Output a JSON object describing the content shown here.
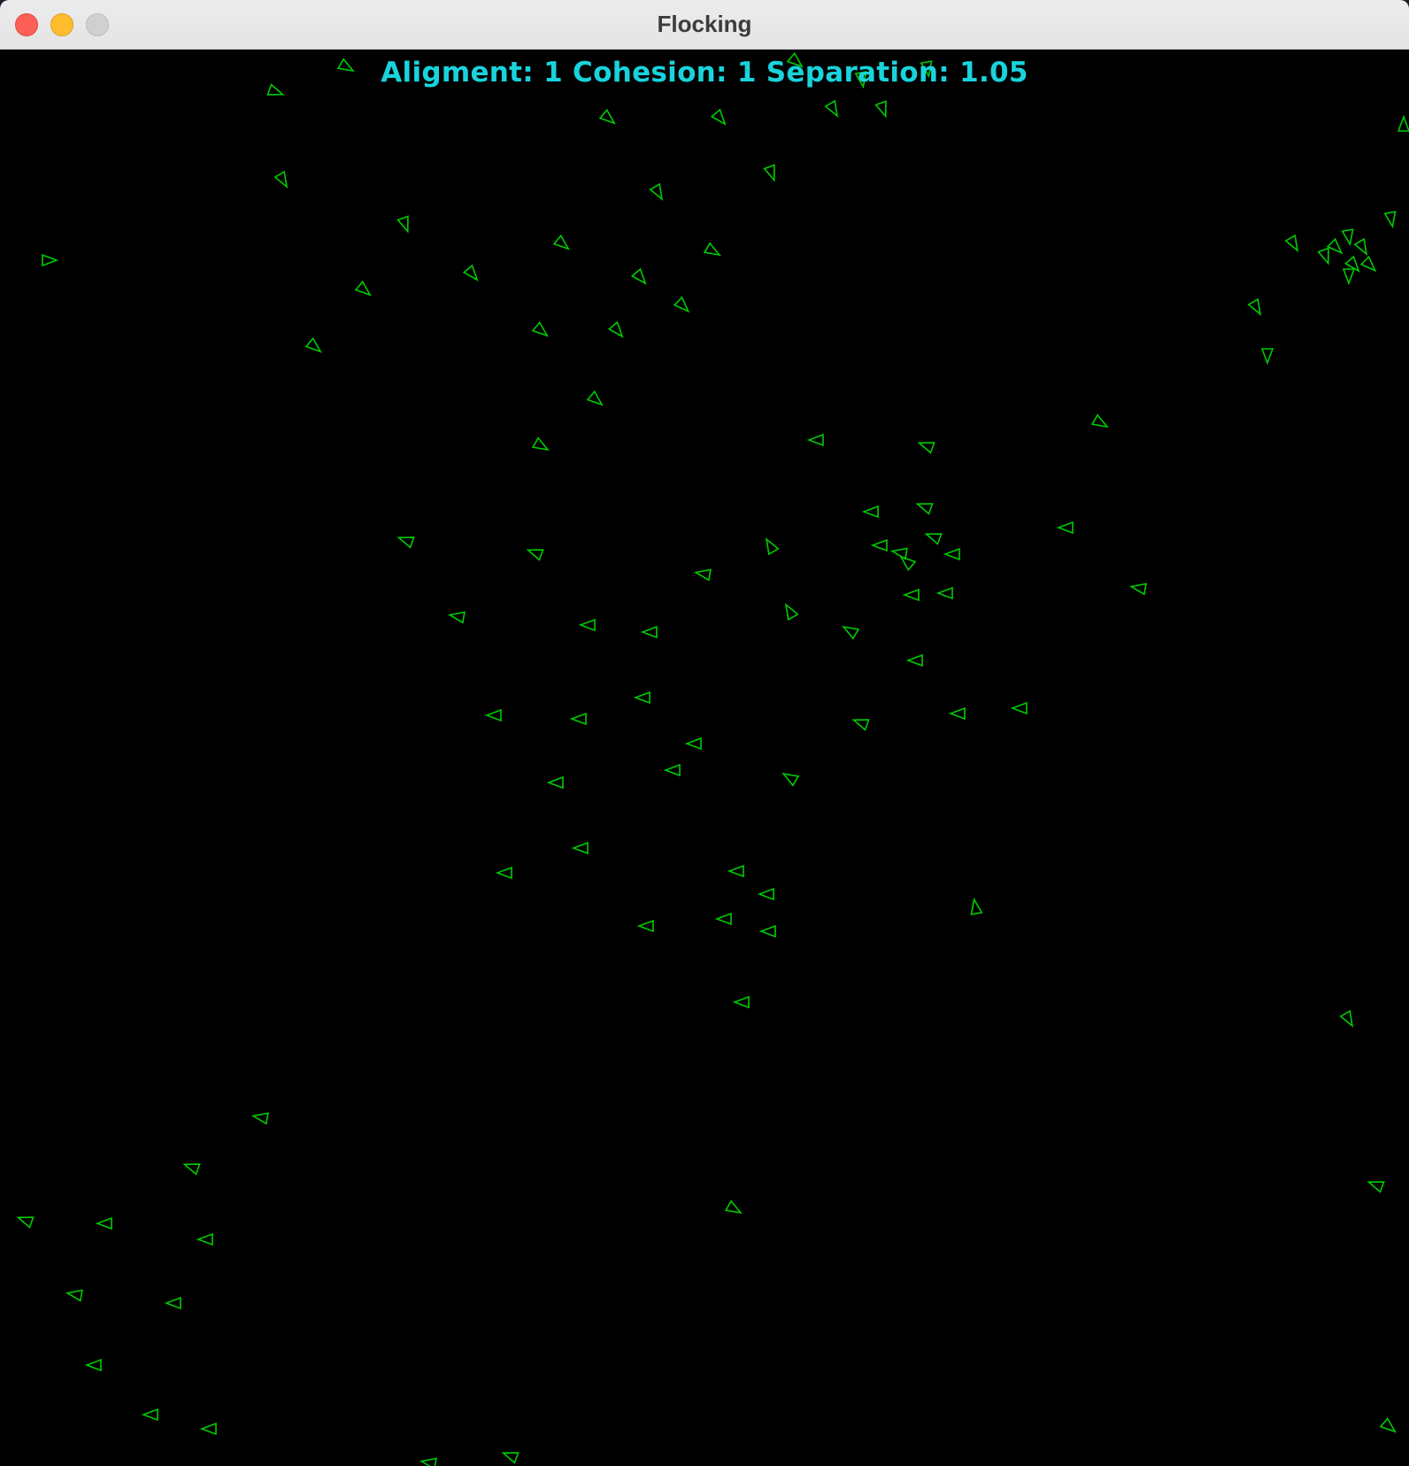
{
  "window": {
    "title": "Flocking"
  },
  "hud": {
    "alignment_label": "Aligment:",
    "alignment_value": "1",
    "cohesion_label": "Cohesion:",
    "cohesion_value": "1",
    "separation_label": "Separation:",
    "separation_value": "1.05"
  },
  "colors": {
    "boid_stroke": "#00cc00",
    "hud_text": "#19d3dc",
    "background": "#000000"
  },
  "icons": {
    "close": "close-icon",
    "minimize": "minimize-icon",
    "maximize": "maximize-icon",
    "boid": "triangle-icon"
  }
}
